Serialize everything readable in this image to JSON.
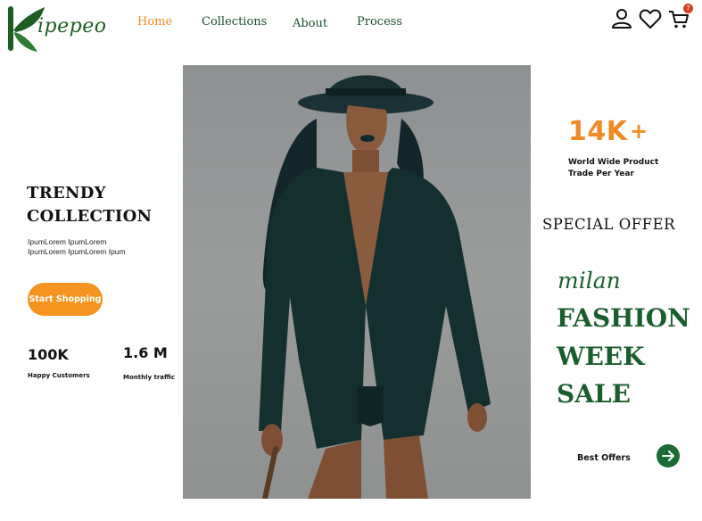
{
  "brand": {
    "name": "ipepeo",
    "logo_letter": "K"
  },
  "nav": {
    "items": [
      {
        "label": "Home",
        "active": true
      },
      {
        "label": "Collections",
        "active": false
      },
      {
        "label": "About",
        "active": false
      },
      {
        "label": "Process",
        "active": false
      }
    ]
  },
  "header_icons": {
    "account": "user-icon",
    "wishlist": "heart-icon",
    "cart": "cart-icon",
    "cart_count": "7"
  },
  "hero": {
    "title_line1": "TRENDY",
    "title_line2": "COLLECTION",
    "subtitle_line1": "IpumLorem IpumLorem",
    "subtitle_line2": "IpumLorem IpumLorem Ipum",
    "cta_label": "Start Shopping"
  },
  "stats": [
    {
      "value": "100K",
      "label": "Happy Customers"
    },
    {
      "value": "1.6 M",
      "label": "Monthly traffic"
    }
  ],
  "highlight": {
    "value": "14K",
    "suffix": "+",
    "label_line1": "World Wide  Product",
    "label_line2": "Trade Per Year"
  },
  "offer": {
    "heading": "SPECIAL OFFER",
    "line1": "milan",
    "line2": "FASHION",
    "line3": "WEEK",
    "line4": "SALE",
    "cta_label": "Best Offers"
  },
  "colors": {
    "brand_green": "#1b5e20",
    "accent_orange": "#f08a24",
    "button_orange": "#f5941f",
    "arrow_button_green": "#1b6b35",
    "badge_red": "#d9411e"
  }
}
